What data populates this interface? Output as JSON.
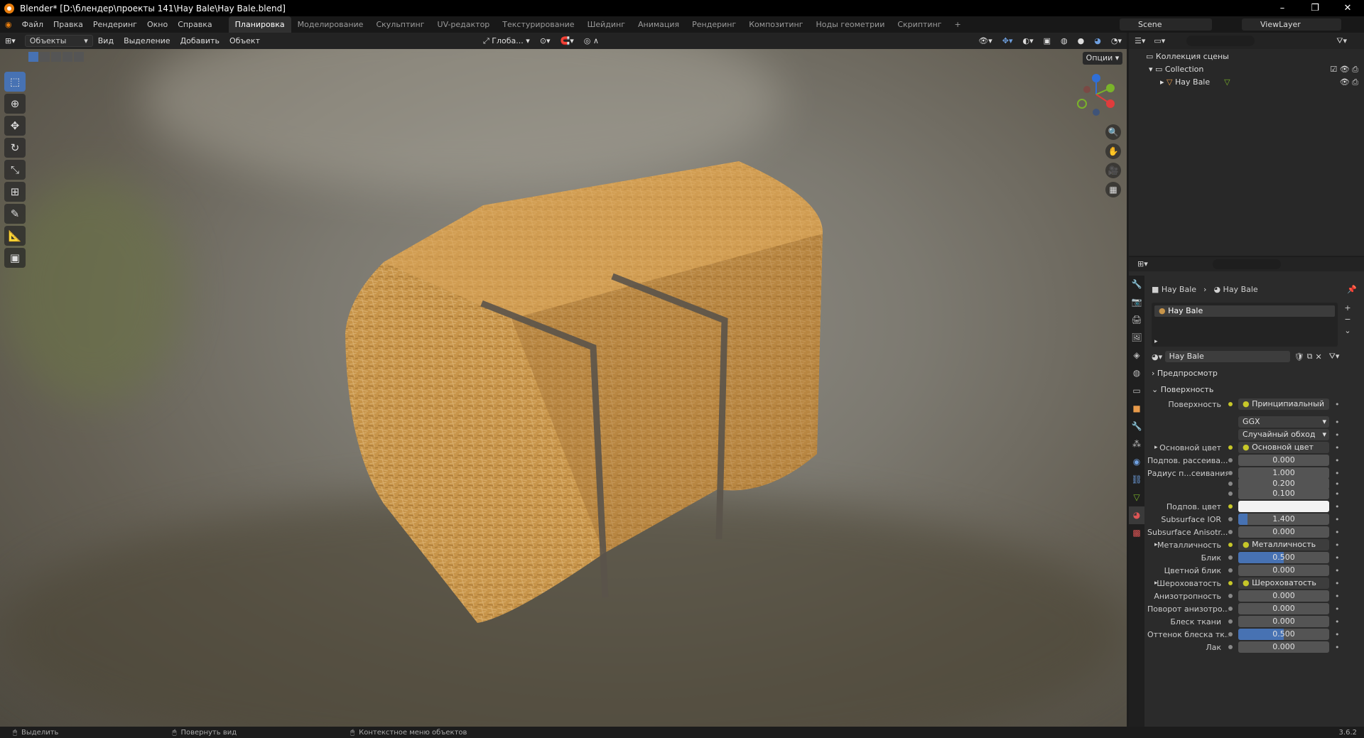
{
  "window": {
    "title": "Blender* [D:\\блендер\\проекты 141\\Hay Bale\\Hay Bale.blend]"
  },
  "menu": [
    "Файл",
    "Правка",
    "Рендеринг",
    "Окно",
    "Справка"
  ],
  "workspaces": [
    "Планировка",
    "Моделирование",
    "Скульптинг",
    "UV-редактор",
    "Текстурирование",
    "Шейдинг",
    "Анимация",
    "Рендеринг",
    "Композитинг",
    "Ноды геометрии",
    "Скриптинг"
  ],
  "scene": {
    "name": "Scene",
    "view_layer": "ViewLayer"
  },
  "viewport_header": {
    "mode": "Объекты",
    "menus": [
      "Вид",
      "Выделение",
      "Добавить",
      "Объект"
    ],
    "orientation": "Глоба...",
    "options": "Опции"
  },
  "outliner": {
    "root": "Коллекция сцены",
    "collection": "Collection",
    "object": "Hay Bale"
  },
  "properties": {
    "breadcrumb_object": "Hay Bale",
    "breadcrumb_material": "Hay Bale",
    "slot": "Hay Bale",
    "material_name": "Hay Bale",
    "preview_label": "Предпросмотр",
    "surface_label": "Поверхность",
    "rows": [
      {
        "label": "Поверхность",
        "value": "Принципиальный BSDF",
        "type": "link"
      },
      {
        "label": "",
        "value": "GGX",
        "type": "select"
      },
      {
        "label": "",
        "value": "Случайный обход",
        "type": "select"
      },
      {
        "label": "Основной цвет",
        "value": "Основной цвет",
        "type": "link",
        "arrow": true
      },
      {
        "label": "Подпов. рассеива...",
        "value": "0.000",
        "type": "num",
        "fill": 0
      },
      {
        "label": "Радиус п...сеивания",
        "value": "1.000",
        "type": "num",
        "fill": 0
      },
      {
        "label": "",
        "value": "0.200",
        "type": "num",
        "fill": 0
      },
      {
        "label": "",
        "value": "0.100",
        "type": "num",
        "fill": 0
      },
      {
        "label": "Подпов. цвет",
        "value": "",
        "type": "color"
      },
      {
        "label": "Subsurface IOR",
        "value": "1.400",
        "type": "num",
        "fill": 0.1
      },
      {
        "label": "Subsurface Anisotr...",
        "value": "0.000",
        "type": "num",
        "fill": 0
      },
      {
        "label": "Металличность",
        "value": "Металличность",
        "type": "link",
        "arrow": true
      },
      {
        "label": "Блик",
        "value": "0.500",
        "type": "num",
        "fill": 0.5
      },
      {
        "label": "Цветной блик",
        "value": "0.000",
        "type": "num",
        "fill": 0
      },
      {
        "label": "Шероховатость",
        "value": "Шероховатость",
        "type": "link",
        "arrow": true
      },
      {
        "label": "Анизотропность",
        "value": "0.000",
        "type": "num",
        "fill": 0
      },
      {
        "label": "Поворот анизотро...",
        "value": "0.000",
        "type": "num",
        "fill": 0
      },
      {
        "label": "Блеск ткани",
        "value": "0.000",
        "type": "num",
        "fill": 0
      },
      {
        "label": "Оттенок блеска тк...",
        "value": "0.500",
        "type": "num",
        "fill": 0.5
      },
      {
        "label": "Лак",
        "value": "0.000",
        "type": "num",
        "fill": 0
      }
    ]
  },
  "status": {
    "select": "Выделить",
    "rotate": "Повернуть вид",
    "context": "Контекстное меню объектов",
    "version": "3.6.2"
  }
}
